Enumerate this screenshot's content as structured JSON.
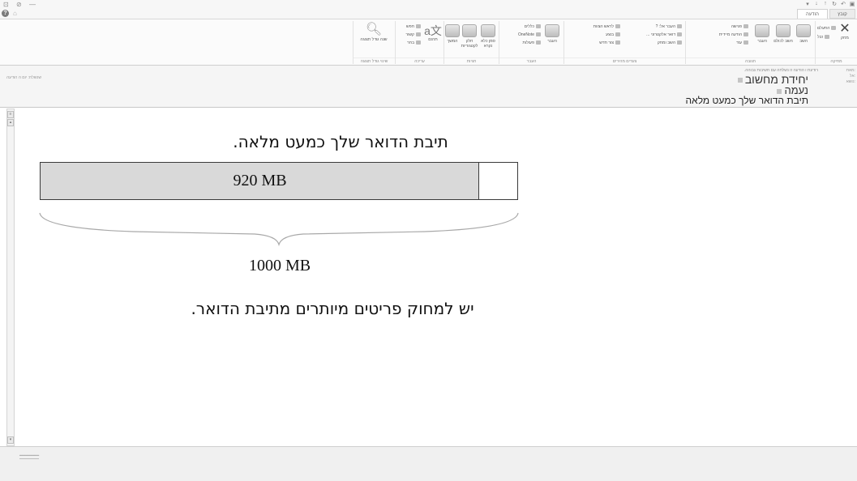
{
  "window": {
    "title_icons": [
      "window-icon",
      "restore-icon",
      "minimize-icon"
    ],
    "quick_access": [
      "save-icon",
      "undo-icon",
      "redo-icon",
      "up-icon",
      "down-icon",
      "customize-icon"
    ]
  },
  "ribbon": {
    "tabs": {
      "file": "קובץ",
      "home": "הודעה"
    },
    "groups": {
      "delete": {
        "label": "מחיקה",
        "delete_btn": "מחק",
        "ignore": "התעלם",
        "junk": "זבל"
      },
      "respond": {
        "label": "תגובה",
        "reply": "השב",
        "reply_all": "השב לכולם",
        "forward": "העבר",
        "meeting": "פגישה",
        "im": "הודעה מיידית",
        "more": "עוד"
      },
      "quick_steps": {
        "label": "צעדים מהירים",
        "items": [
          "העבר אל: ?",
          "לראש הצוות",
          "דואר אלקטרוני ...",
          "בוצע",
          "השב ומחק",
          "צור חדש"
        ]
      },
      "move": {
        "label": "העבר",
        "move_btn": "העבר",
        "rules": "כללים",
        "onenote": "OneNote",
        "actions": "פעולות"
      },
      "tags": {
        "label": "תגיות",
        "unread": "סמן כלא נקרא",
        "categorize": "חלק לקטגוריות",
        "followup": "המשך"
      },
      "editing": {
        "label": "עריכה",
        "translate": "תרגם",
        "find": "חפש",
        "related": "קשור",
        "select": "בחר"
      },
      "zoom": {
        "label": "שינוי גודל תצוגה",
        "zoom_btn": "שנה גודל תצוגה"
      }
    }
  },
  "message": {
    "sent_info": "רודעת ו הודעה זו נשלחה עם חשיבות גבוהה.",
    "from": "יחידת מחשוב",
    "to": "נעמה",
    "subject": "תיבת הדואר שלך כמעט מלאה",
    "field_labels": [
      "מאת:",
      "אל:",
      "נושא:"
    ],
    "left_meta": "שנשלח: יום ה הודעה"
  },
  "body": {
    "title": "תיבת הדואר שלך כמעט מלאה.",
    "used": "920 MB",
    "total": "1000 MB",
    "used_fraction": 0.92,
    "action": "יש למחוק פריטים מיותרים מתיבת הדואר."
  },
  "status": {
    "text": "━━━━━━━━"
  },
  "colors": {
    "fill": "#d9d9d9",
    "border": "#3a3a3a",
    "ribbon": "#fbfbfb",
    "header": "#f5f5f5"
  }
}
